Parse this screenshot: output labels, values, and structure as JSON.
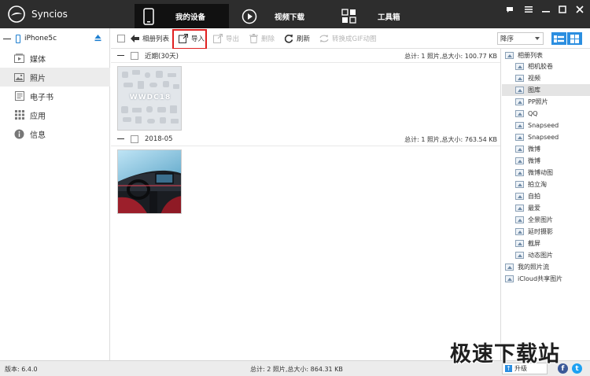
{
  "app": {
    "title": "Syncios"
  },
  "nav": {
    "device_tab": "我的设备",
    "video_tab": "视频下载",
    "tools_tab": "工具箱"
  },
  "sidebar": {
    "device_name": "iPhone5c",
    "items": [
      {
        "label": "媒体",
        "icon": "music-icon"
      },
      {
        "label": "照片",
        "icon": "photo-icon"
      },
      {
        "label": "电子书",
        "icon": "book-icon"
      },
      {
        "label": "应用",
        "icon": "apps-grid-icon"
      },
      {
        "label": "信息",
        "icon": "info-icon"
      }
    ],
    "active_index": 1
  },
  "toolbar": {
    "album_list": "相册列表",
    "import": "导入",
    "export": "导出",
    "delete": "删除",
    "refresh": "刷新",
    "convert_gif": "转换成GIF动图",
    "sort_value": "降序"
  },
  "groups": [
    {
      "title": "近期(30天)",
      "total": "总计: 1 照片,总大小: 100.77 KB",
      "thumb_text": "WWDC18"
    },
    {
      "title": "2018-05",
      "total": "总计: 1 照片,总大小: 763.54 KB"
    }
  ],
  "albums": {
    "root": "相册列表",
    "items": [
      "相机胶卷",
      "视频",
      "图库",
      "PP照片",
      "QQ",
      "Snapseed",
      "Snapseed",
      "微博",
      "微博",
      "微博动图",
      "拍立淘",
      "自拍",
      "最爱",
      "全景图片",
      "延时摄影",
      "截屏",
      "动态图片"
    ],
    "selected_index": 2,
    "photo_stream": "我的照片流",
    "icloud": "iCloud共享图片"
  },
  "status": {
    "version": "版本: 6.4.0",
    "total": "总计: 2 照片,总大小: 864.31 KB",
    "upgrade": "升级"
  },
  "watermark": "极速下载站",
  "colors": {
    "accent": "#2b8ee0",
    "highlight": "#e02020",
    "topbar": "#2d2d2d"
  }
}
